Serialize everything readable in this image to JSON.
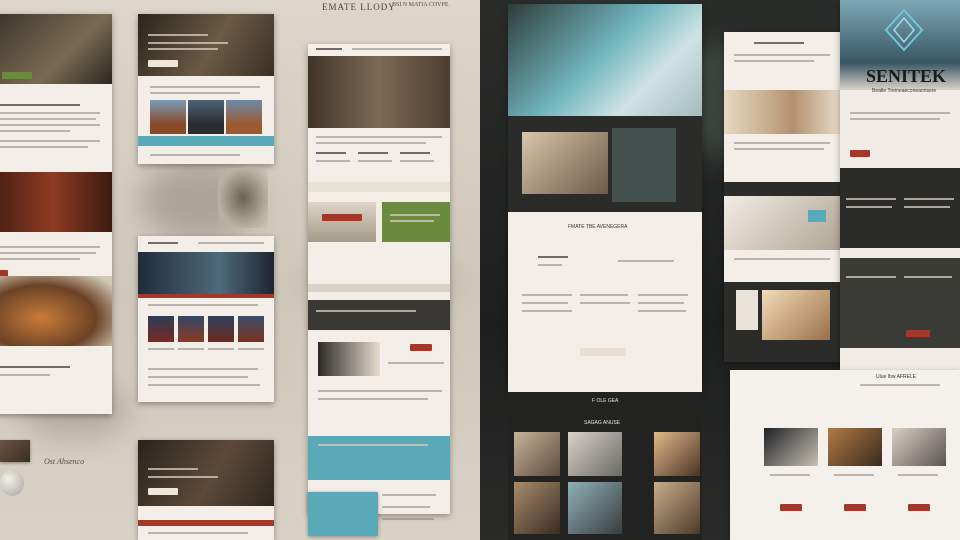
{
  "top_banner": {
    "text": "EMATE LLODY"
  },
  "top_banner_sub": {
    "text": "BSI N MATIA COVPE"
  },
  "bottom_signature": {
    "text": "Ost Ahsenco"
  },
  "logo": {
    "text": "SENITEK"
  },
  "logo_tagline": {
    "text": "Beatle Tremeaeconeaonsere"
  },
  "dark_mid_caption": {
    "text": "FMATE TBE AVENEGERA"
  },
  "dark_mid_title": {
    "text": "F OLE GEA"
  },
  "section_label": {
    "text": "SAGAG ANUSE"
  },
  "right_caption": {
    "text": "Ulue Ibw AFRELE"
  },
  "colors": {
    "accent_red": "#a3382a",
    "accent_teal": "#5aa9b8",
    "accent_green": "#6a8a3d",
    "paper": "#f3efe8",
    "dark": "#2b2b29"
  }
}
